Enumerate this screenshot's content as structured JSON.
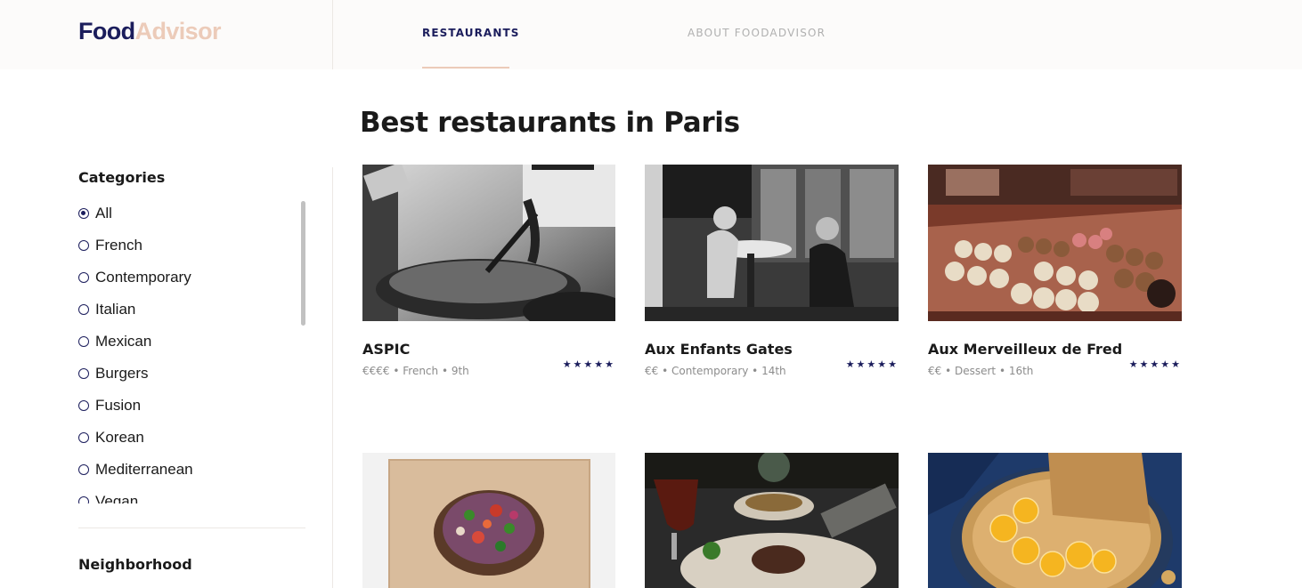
{
  "header": {
    "logo_part1": "Food",
    "logo_part2": "Advisor",
    "nav": [
      {
        "label": "RESTAURANTS",
        "active": true
      },
      {
        "label": "ABOUT FOODADVISOR",
        "active": false
      }
    ]
  },
  "colors": {
    "brand_navy": "#1b1d5c",
    "brand_peach": "#eccbb9",
    "muted_text": "#8c8c8c"
  },
  "page_title": "Best restaurants in Paris",
  "sidebar": {
    "categories_heading": "Categories",
    "selected_category": "All",
    "categories": [
      "All",
      "French",
      "Contemporary",
      "Italian",
      "Mexican",
      "Burgers",
      "Fusion",
      "Korean",
      "Mediterranean",
      "Vegan"
    ],
    "neighborhood_heading": "Neighborhood"
  },
  "restaurants": [
    {
      "name": "ASPIC",
      "meta": "€€€€ • French • 9th",
      "stars": "★★★★★",
      "image_icon": "wok-cooking-photo"
    },
    {
      "name": "Aux Enfants Gates",
      "meta": "€€ • Contemporary • 14th",
      "stars": "★★★★★",
      "image_icon": "cafe-terrace-bw-photo"
    },
    {
      "name": "Aux Merveilleux de Fred",
      "meta": "€€ • Dessert • 16th",
      "stars": "★★★★★",
      "image_icon": "pastry-display-photo"
    },
    {
      "name": "",
      "meta": "",
      "stars": "",
      "image_icon": "salad-bowl-photo"
    },
    {
      "name": "",
      "meta": "",
      "stars": "",
      "image_icon": "dessert-plate-photo"
    },
    {
      "name": "",
      "meta": "",
      "stars": "",
      "image_icon": "crepe-orange-photo"
    }
  ]
}
